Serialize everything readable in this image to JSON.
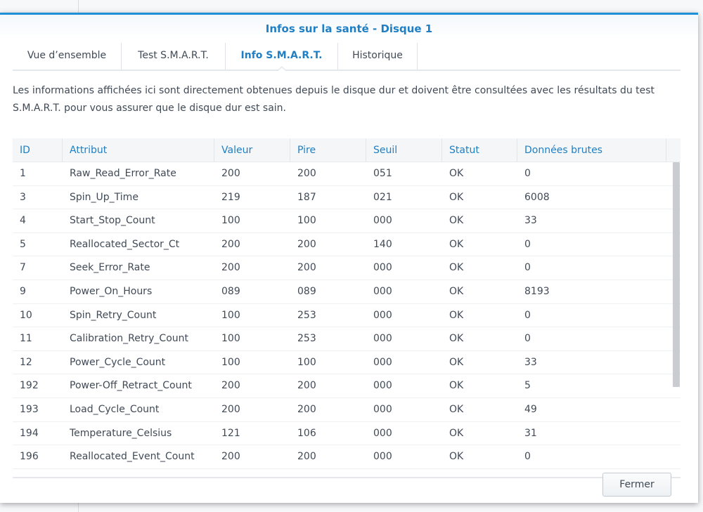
{
  "dialog": {
    "title": "Infos sur la santé - Disque 1"
  },
  "tabs": [
    {
      "label": "Vue d’ensemble",
      "active": false
    },
    {
      "label": "Test S.M.A.R.T.",
      "active": false
    },
    {
      "label": "Info S.M.A.R.T.",
      "active": true
    },
    {
      "label": "Historique",
      "active": false
    }
  ],
  "description": "Les informations affichées ici sont directement obtenues depuis le disque dur et doivent être consultées avec les résultats du test S.M.A.R.T. pour vous assurer que le disque dur est sain.",
  "table": {
    "columns": [
      "ID",
      "Attribut",
      "Valeur",
      "Pire",
      "Seuil",
      "Statut",
      "Données brutes"
    ],
    "rows": [
      [
        "1",
        "Raw_Read_Error_Rate",
        "200",
        "200",
        "051",
        "OK",
        "0"
      ],
      [
        "3",
        "Spin_Up_Time",
        "219",
        "187",
        "021",
        "OK",
        "6008"
      ],
      [
        "4",
        "Start_Stop_Count",
        "100",
        "100",
        "000",
        "OK",
        "33"
      ],
      [
        "5",
        "Reallocated_Sector_Ct",
        "200",
        "200",
        "140",
        "OK",
        "0"
      ],
      [
        "7",
        "Seek_Error_Rate",
        "200",
        "200",
        "000",
        "OK",
        "0"
      ],
      [
        "9",
        "Power_On_Hours",
        "089",
        "089",
        "000",
        "OK",
        "8193"
      ],
      [
        "10",
        "Spin_Retry_Count",
        "100",
        "253",
        "000",
        "OK",
        "0"
      ],
      [
        "11",
        "Calibration_Retry_Count",
        "100",
        "253",
        "000",
        "OK",
        "0"
      ],
      [
        "12",
        "Power_Cycle_Count",
        "100",
        "100",
        "000",
        "OK",
        "33"
      ],
      [
        "192",
        "Power-Off_Retract_Count",
        "200",
        "200",
        "000",
        "OK",
        "5"
      ],
      [
        "193",
        "Load_Cycle_Count",
        "200",
        "200",
        "000",
        "OK",
        "49"
      ],
      [
        "194",
        "Temperature_Celsius",
        "121",
        "106",
        "000",
        "OK",
        "31"
      ],
      [
        "196",
        "Reallocated_Event_Count",
        "200",
        "200",
        "000",
        "OK",
        "0"
      ]
    ]
  },
  "footer": {
    "close_label": "Fermer"
  },
  "colors": {
    "accent": "#1f7fc4",
    "title_border": "#1f8fd6"
  }
}
